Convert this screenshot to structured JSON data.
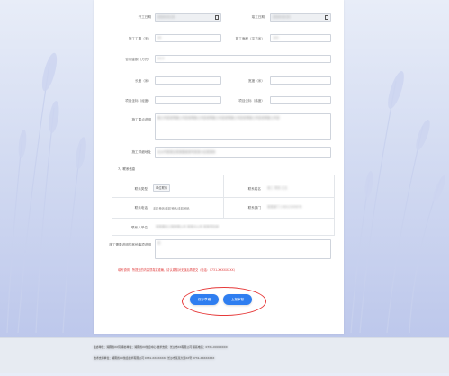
{
  "form": {
    "start_date_label": "开工日期",
    "end_date_label": "竣工日期",
    "duration_label": "施工工期（天）",
    "area_label": "施工面积（平方米）",
    "amount_label": "合同金额（万元）",
    "length_label": "长度（米）",
    "width_label": "宽度（米）",
    "longitude_label": "项目坐标（经度）",
    "latitude_label": "项目坐标（纬度）",
    "description_label": "施工重点说明",
    "address_label": "施工详细地址",
    "section7_title": "7、联系信息",
    "contact_type_label": "联系类型",
    "contact_type_value": "单位联系",
    "contact_name_label": "联系姓名",
    "contact_phone_label": "联系电话",
    "contact_phone_value": "手机号码/手机号码/手机号码",
    "contact_dept_label": "联系部门",
    "contact_dept_2_label": "联系人单位",
    "remark_label": "施工需要说明的其他事项说明",
    "notice_text": "填写说明：所提交的内容须真实准确，请认真核对无误后再提交（电话：0731-XXXXXXXX）"
  },
  "buttons": {
    "save_label": "保存草稿",
    "submit_label": "上报审核"
  },
  "footer": {
    "line1": "主办单位：湖南省XX局    承办单位：湖南省XX信息中心    技术支持：长沙市XX有限公司    联系电话：0731-XXXXXXXX",
    "line2": "技术支持单位：湖南省XX信息技术有限公司    0731-XXXXXXXX    长沙市某某大道XX号    0731-XXXXXXXX"
  }
}
